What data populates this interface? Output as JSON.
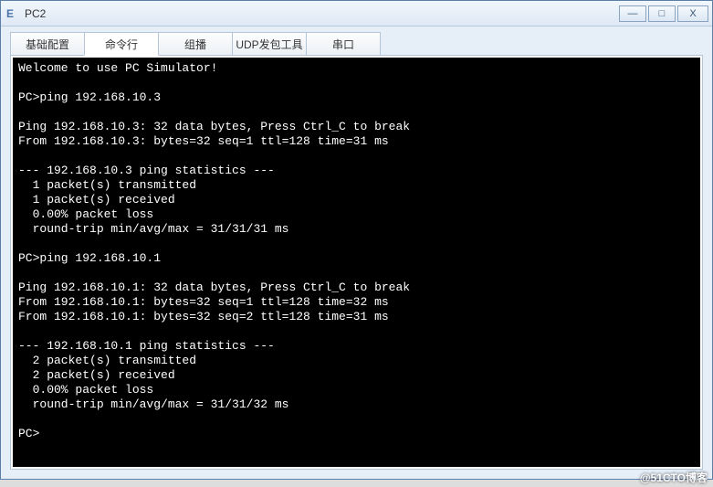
{
  "window": {
    "title": "PC2",
    "icon_char": "E"
  },
  "controls": {
    "minimize": "—",
    "maximize": "□",
    "close": "X"
  },
  "tabs": [
    {
      "label": "基础配置",
      "active": false
    },
    {
      "label": "命令行",
      "active": true
    },
    {
      "label": "组播",
      "active": false
    },
    {
      "label": "UDP发包工具",
      "active": false
    },
    {
      "label": "串口",
      "active": false
    }
  ],
  "terminal_lines": [
    "Welcome to use PC Simulator!",
    "",
    "PC>ping 192.168.10.3",
    "",
    "Ping 192.168.10.3: 32 data bytes, Press Ctrl_C to break",
    "From 192.168.10.3: bytes=32 seq=1 ttl=128 time=31 ms",
    "",
    "--- 192.168.10.3 ping statistics ---",
    "  1 packet(s) transmitted",
    "  1 packet(s) received",
    "  0.00% packet loss",
    "  round-trip min/avg/max = 31/31/31 ms",
    "",
    "PC>ping 192.168.10.1",
    "",
    "Ping 192.168.10.1: 32 data bytes, Press Ctrl_C to break",
    "From 192.168.10.1: bytes=32 seq=1 ttl=128 time=32 ms",
    "From 192.168.10.1: bytes=32 seq=2 ttl=128 time=31 ms",
    "",
    "--- 192.168.10.1 ping statistics ---",
    "  2 packet(s) transmitted",
    "  2 packet(s) received",
    "  0.00% packet loss",
    "  round-trip min/avg/max = 31/31/32 ms",
    "",
    "PC>"
  ],
  "watermark": "@51CTO博客"
}
